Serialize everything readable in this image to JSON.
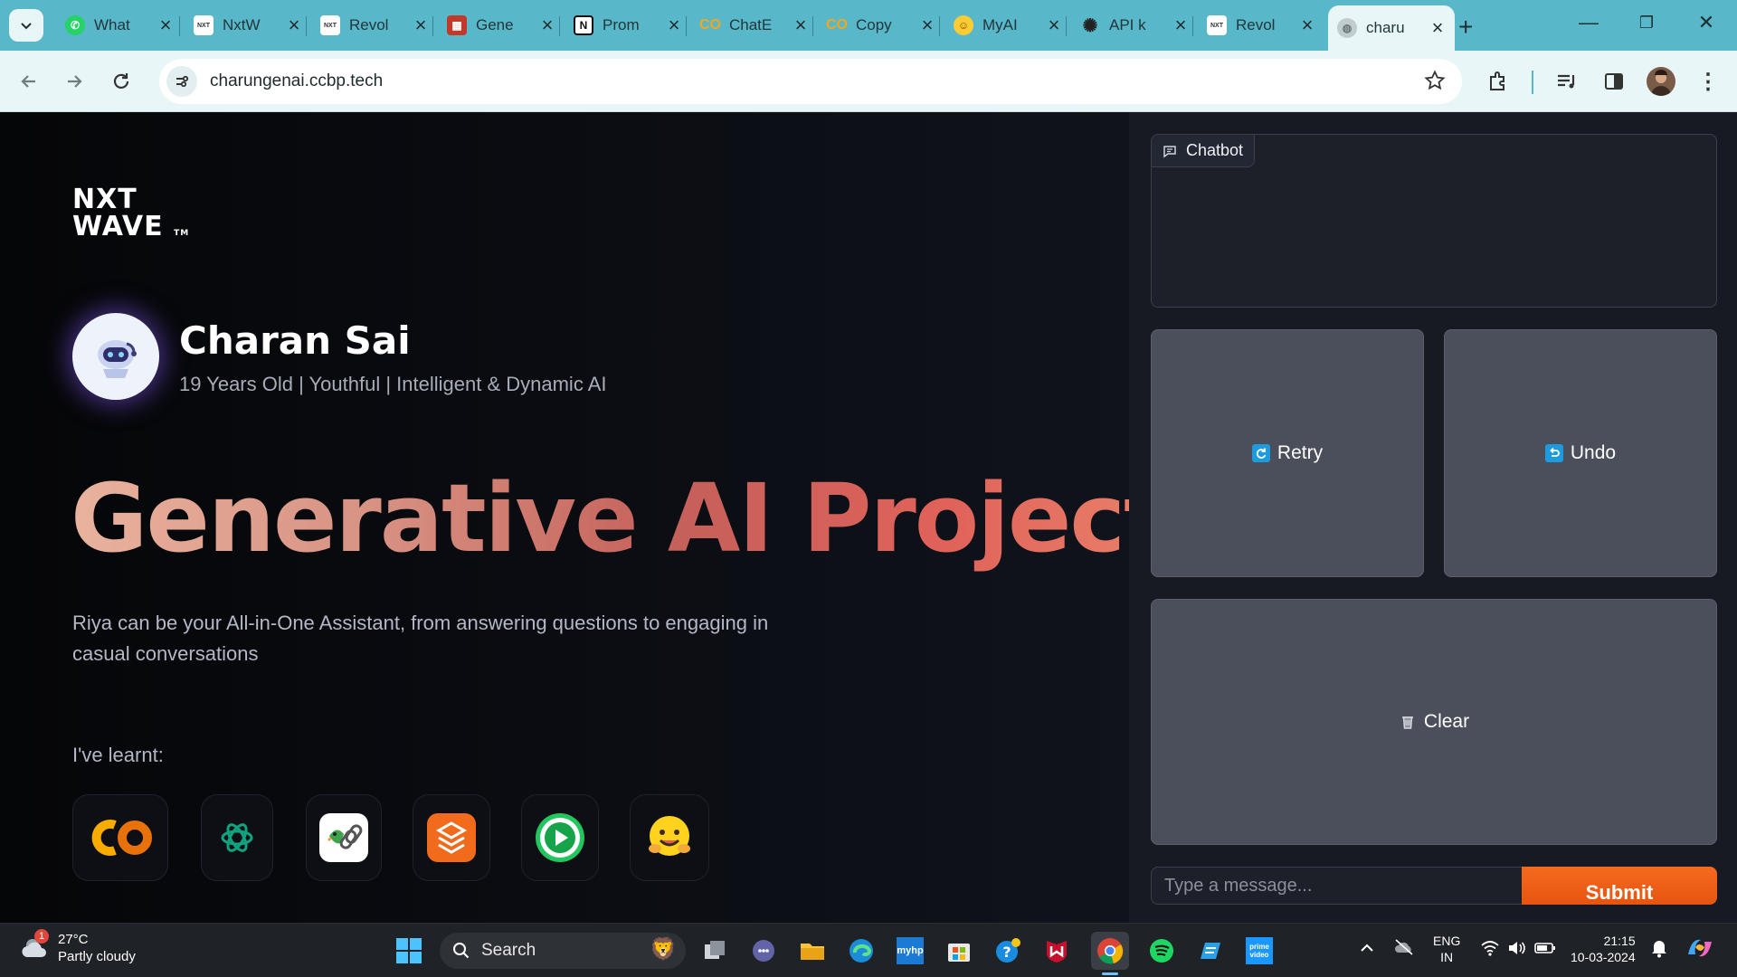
{
  "browser": {
    "tabs": [
      {
        "title": "What",
        "favicon_color": "#25d366"
      },
      {
        "title": "NxtW",
        "favicon_color": "#ffffff"
      },
      {
        "title": "Revol",
        "favicon_color": "#ffffff"
      },
      {
        "title": "Gene",
        "favicon_color": "#c0392b"
      },
      {
        "title": "Prom",
        "favicon_color": "#111111"
      },
      {
        "title": "ChatE",
        "favicon_color": "#f4a71c"
      },
      {
        "title": "Copy",
        "favicon_color": "#f4a71c"
      },
      {
        "title": "MyAI",
        "favicon_color": "#ffcc33"
      },
      {
        "title": "API k",
        "favicon_color": "#222222"
      },
      {
        "title": "Revol",
        "favicon_color": "#ffffff"
      },
      {
        "title": "charu",
        "favicon_color": "#9aa3a6"
      }
    ],
    "url": "charungenai.ccbp.tech"
  },
  "page": {
    "logo_line1": "NXT",
    "logo_line2": "WAVE",
    "logo_tm": "TM",
    "profile_name": "Charan Sai",
    "profile_tagline": "19 Years Old | Youthful | Intelligent & Dynamic AI",
    "hero_title": "Generative AI Project",
    "description": "Riya can be your All-in-One Assistant, from answering questions to engaging in casual conversations",
    "learnt_label": "I've learnt:",
    "tools": [
      "colab-icon",
      "chatgpt-icon",
      "langchain-icon",
      "stack-icon",
      "play-icon",
      "huggingface-icon"
    ]
  },
  "chat": {
    "chatbot_label": "Chatbot",
    "retry_label": "Retry",
    "undo_label": "Undo",
    "clear_label": "Clear",
    "input_placeholder": "Type a message...",
    "submit_label": "Submit"
  },
  "taskbar": {
    "temperature": "27°C",
    "weather": "Partly cloudy",
    "weather_badge": "1",
    "search_label": "Search",
    "language_top": "ENG",
    "language_bottom": "IN",
    "time": "21:15",
    "date": "10-03-2024"
  },
  "colors": {
    "accent_orange": "#f46a1f",
    "browser_teal": "#58b7c8",
    "hero_gradient_start": "#e9b39e",
    "hero_gradient_end": "#e0625a"
  }
}
